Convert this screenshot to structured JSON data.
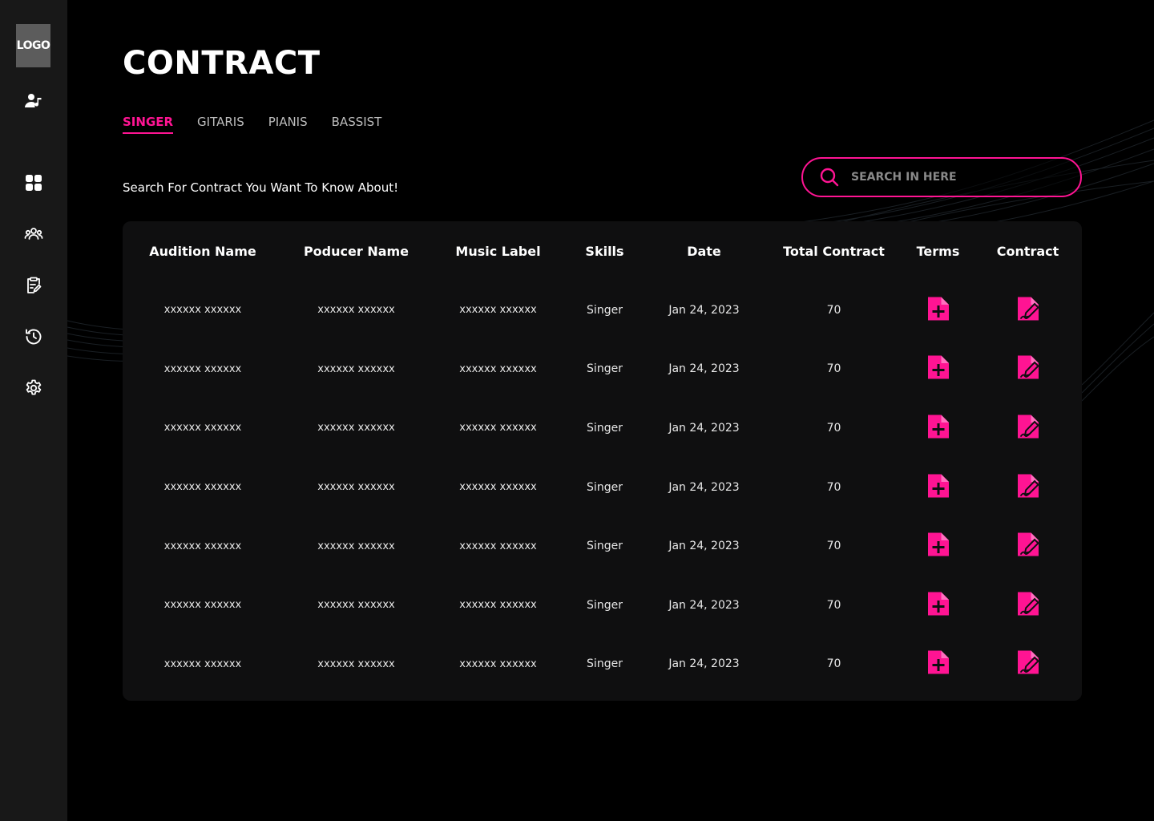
{
  "sidebar": {
    "logo": "LOGO",
    "icons": [
      "user-music-icon",
      "dashboard-grid-icon",
      "group-icon",
      "clipboard-edit-icon",
      "history-icon",
      "settings-gear-icon"
    ]
  },
  "page": {
    "title": "CONTRACT",
    "subtitle": "Search For Contract You Want To Know About!"
  },
  "tabs": [
    {
      "label": "SINGER",
      "active": true
    },
    {
      "label": "GITARIS",
      "active": false
    },
    {
      "label": "PIANIS",
      "active": false
    },
    {
      "label": "BASSIST",
      "active": false
    }
  ],
  "search": {
    "placeholder": "SEARCH IN HERE"
  },
  "table": {
    "headers": [
      "Audition Name",
      "Poducer Name",
      "Music Label",
      "Skills",
      "Date",
      "Total Contract",
      "Terms",
      "Contract"
    ],
    "rows": [
      {
        "audition": "xxxxxx xxxxxx",
        "producer": "xxxxxx xxxxxx",
        "label": "xxxxxx xxxxxx",
        "skills": "Singer",
        "date": "Jan 24, 2023",
        "total": "70"
      },
      {
        "audition": "xxxxxx xxxxxx",
        "producer": "xxxxxx xxxxxx",
        "label": "xxxxxx xxxxxx",
        "skills": "Singer",
        "date": "Jan 24, 2023",
        "total": "70"
      },
      {
        "audition": "xxxxxx xxxxxx",
        "producer": "xxxxxx xxxxxx",
        "label": "xxxxxx xxxxxx",
        "skills": "Singer",
        "date": "Jan 24, 2023",
        "total": "70"
      },
      {
        "audition": "xxxxxx xxxxxx",
        "producer": "xxxxxx xxxxxx",
        "label": "xxxxxx xxxxxx",
        "skills": "Singer",
        "date": "Jan 24, 2023",
        "total": "70"
      },
      {
        "audition": "xxxxxx xxxxxx",
        "producer": "xxxxxx xxxxxx",
        "label": "xxxxxx xxxxxx",
        "skills": "Singer",
        "date": "Jan 24, 2023",
        "total": "70"
      },
      {
        "audition": "xxxxxx xxxxxx",
        "producer": "xxxxxx xxxxxx",
        "label": "xxxxxx xxxxxx",
        "skills": "Singer",
        "date": "Jan 24, 2023",
        "total": "70"
      },
      {
        "audition": "xxxxxx xxxxxx",
        "producer": "xxxxxx xxxxxx",
        "label": "xxxxxx xxxxxx",
        "skills": "Singer",
        "date": "Jan 24, 2023",
        "total": "70"
      }
    ],
    "terms_icon": "file-plus-icon",
    "contract_icon": "file-sign-icon"
  },
  "colors": {
    "accent": "#ff1493",
    "background": "#000000",
    "sidebar": "#181818",
    "card": "#0f0f10"
  }
}
